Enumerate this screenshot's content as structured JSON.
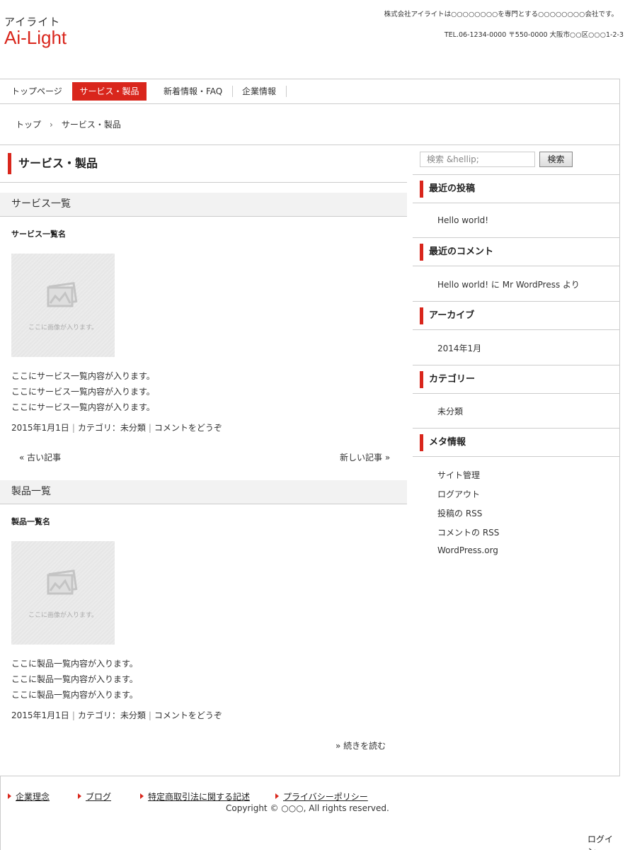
{
  "header": {
    "logo_kana": "アイライト",
    "logo_text": "Ai-Light",
    "tagline": "株式会社アイライトは○○○○○○○○を専門とする○○○○○○○○会社です。",
    "contact": "TEL.06-1234-0000 〒550-0000 大阪市○○区○○○1-2-3"
  },
  "nav": {
    "items": [
      {
        "label": "トップページ"
      },
      {
        "label": "サービス・製品"
      },
      {
        "label": "新着情報・FAQ"
      },
      {
        "label": "企業情報"
      }
    ],
    "active_color": "#d9261c"
  },
  "breadcrumb": {
    "home": "トップ",
    "separator": "›",
    "current": "サービス・製品"
  },
  "main": {
    "page_title": "サービス・製品",
    "sections": [
      {
        "heading": "サービス一覧",
        "item_name": "サービス一覧名",
        "image_caption": "ここに画像が入ります。",
        "lines": [
          "ここにサービス一覧内容が入ります。",
          "ここにサービス一覧内容が入ります。",
          "ここにサービス一覧内容が入ります。"
        ],
        "date": "2015年1月1日",
        "category": "カテゴリ：未分類",
        "comment": "コメントをどうぞ"
      },
      {
        "heading": "製品一覧",
        "item_name": "製品一覧名",
        "image_caption": "ここに画像が入ります。",
        "lines": [
          "ここに製品一覧内容が入ります。",
          "ここに製品一覧内容が入ります。",
          "ここに製品一覧内容が入ります。"
        ],
        "date": "2015年1月1日",
        "category": "カテゴリ：未分類",
        "comment": "コメントをどうぞ"
      }
    ],
    "pager": {
      "prev": "« 古い記事",
      "next": "新しい記事 »"
    },
    "read_more": "» 続きを読む"
  },
  "sidebar": {
    "search_placeholder": "検索 &hellip;",
    "search_button": "検索",
    "widgets": [
      {
        "title": "最近の投稿",
        "items": [
          "Hello world!"
        ]
      },
      {
        "title": "最近のコメント",
        "items": [
          "Hello world! に Mr WordPress より"
        ]
      },
      {
        "title": "アーカイブ",
        "items": [
          "2014年1月"
        ]
      },
      {
        "title": "カテゴリー",
        "items": [
          "未分類"
        ]
      },
      {
        "title": "メタ情報",
        "items": [
          "サイト管理",
          "ログアウト",
          "投稿の RSS",
          "コメントの RSS",
          "WordPress.org"
        ]
      }
    ]
  },
  "footer": {
    "links": [
      "企業理念",
      "ブログ",
      "特定商取引法に関する記述",
      "プライバシーポリシー"
    ],
    "copyright": "Copyright © ○○○, All rights reserved.",
    "login": "ログイン"
  }
}
